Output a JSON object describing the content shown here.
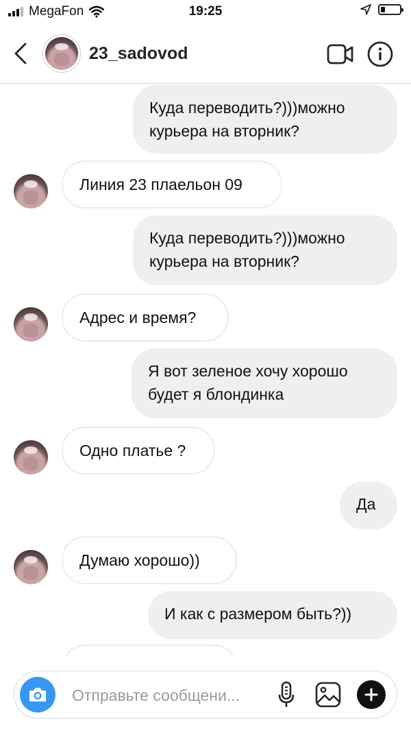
{
  "status_bar": {
    "carrier": "MegaFon",
    "time": "19:25",
    "battery_level": 0.22,
    "icons": [
      "signal-icon",
      "wifi-icon",
      "location-arrow-icon",
      "battery-icon"
    ]
  },
  "header": {
    "username": "23_sadovod",
    "icons": [
      "back-chevron-icon",
      "video-call-icon",
      "info-icon"
    ]
  },
  "messages": [
    {
      "from": "me",
      "text": "Куда переводить?)))можно курьера на вторник?"
    },
    {
      "from": "them",
      "text": "Линия 23 плаельон 09"
    },
    {
      "from": "me",
      "text": "Куда переводить?)))можно курьера на вторник?"
    },
    {
      "from": "them",
      "text": "Адрес и время?"
    },
    {
      "from": "me",
      "text": "Я вот зеленое хочу хорошо будет я блондинка"
    },
    {
      "from": "them",
      "text": "Одно платье ?"
    },
    {
      "from": "me",
      "text": "Да"
    },
    {
      "from": "them",
      "text": "Думаю хорошо))"
    },
    {
      "from": "me",
      "text": "И как с размером быть?))"
    }
  ],
  "composer": {
    "placeholder": "Отправьте сообщени...",
    "icons": [
      "camera-icon",
      "microphone-icon",
      "gallery-icon",
      "plus-icon"
    ],
    "accent_color": "#3897f0"
  }
}
